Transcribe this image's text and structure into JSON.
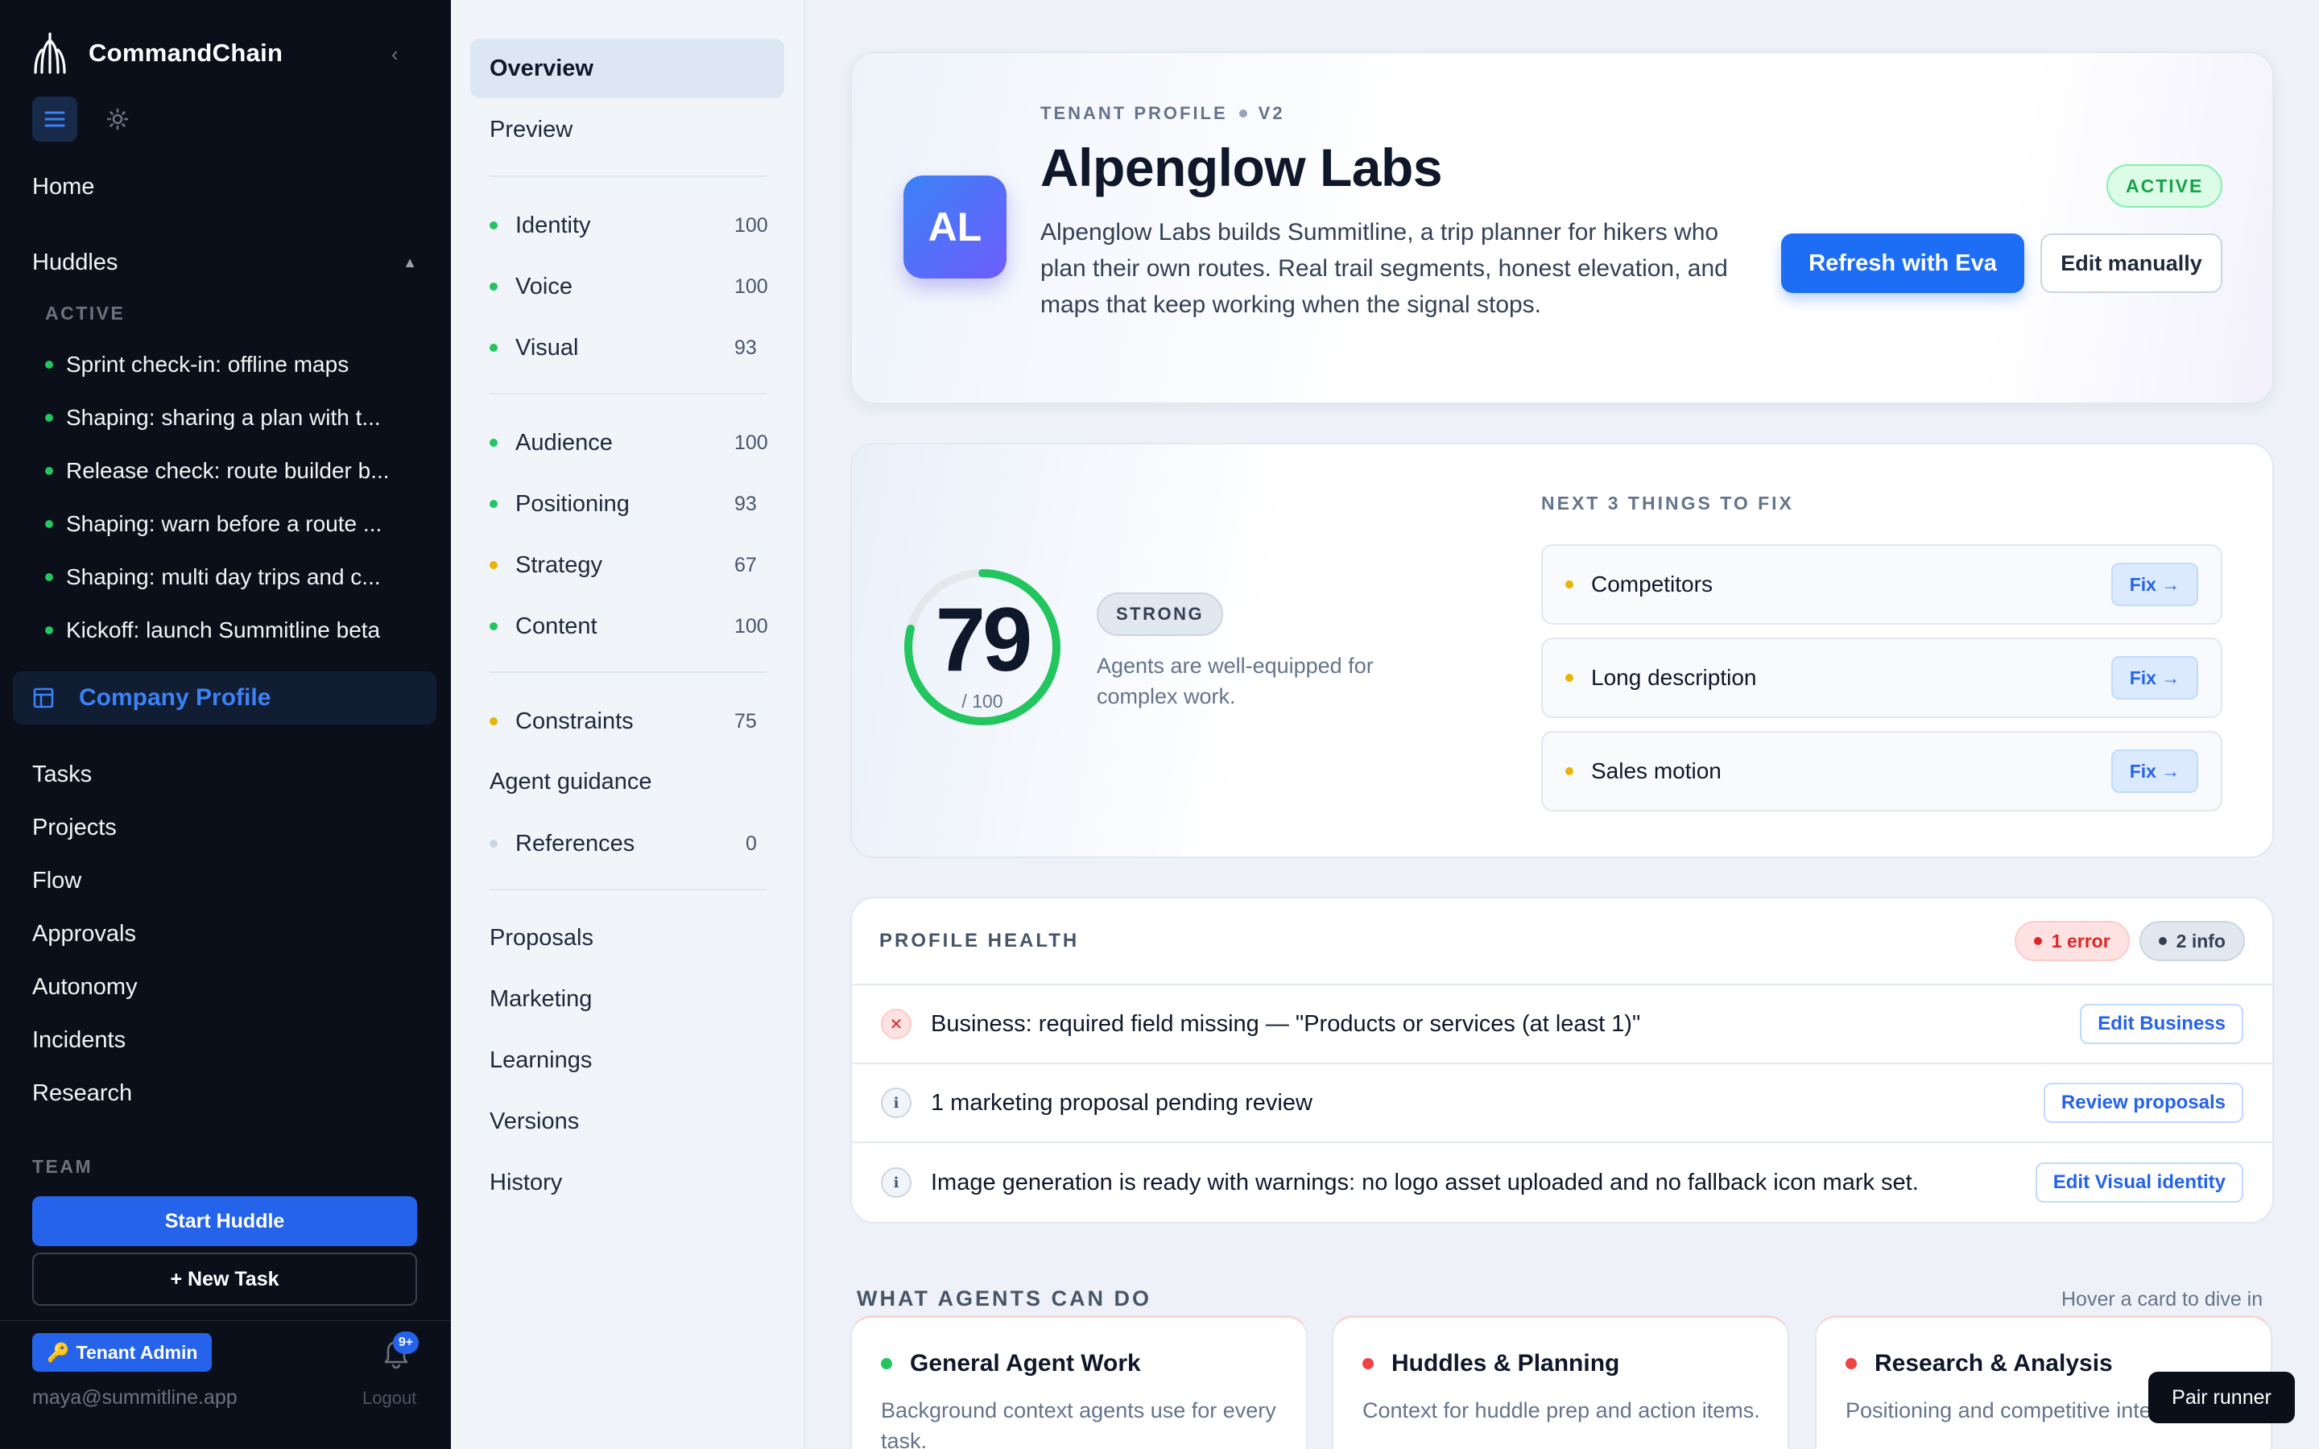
{
  "sidebar": {
    "brand": "CommandChain",
    "home": "Home",
    "huddles": "Huddles",
    "active_label": "ACTIVE",
    "huddles_list": [
      "Sprint check-in: offline maps",
      "Shaping: sharing a plan with t...",
      "Release check: route builder b...",
      "Shaping: warn before a route ...",
      "Shaping: multi day trips and c...",
      "Kickoff: launch Summitline beta"
    ],
    "company_profile": "Company Profile",
    "nav": [
      "Tasks",
      "Projects",
      "Flow",
      "Approvals",
      "Autonomy",
      "Incidents",
      "Research"
    ],
    "team_label": "TEAM",
    "start_huddle": "Start Huddle",
    "new_task": "+ New Task",
    "role": "Tenant Admin",
    "notifications": "9+",
    "email": "maya@summitline.app",
    "logout": "Logout"
  },
  "subnav": {
    "overview": "Overview",
    "preview": "Preview",
    "group1": [
      {
        "label": "Identity",
        "score": "100",
        "color": "#22c55e"
      },
      {
        "label": "Voice",
        "score": "100",
        "color": "#22c55e"
      },
      {
        "label": "Visual",
        "score": "93",
        "color": "#22c55e"
      }
    ],
    "group2": [
      {
        "label": "Audience",
        "score": "100",
        "color": "#22c55e"
      },
      {
        "label": "Positioning",
        "score": "93",
        "color": "#22c55e"
      },
      {
        "label": "Strategy",
        "score": "67",
        "color": "#eab308"
      },
      {
        "label": "Content",
        "score": "100",
        "color": "#22c55e"
      }
    ],
    "constraints": {
      "label": "Constraints",
      "score": "75",
      "color": "#eab308"
    },
    "agent_guidance": "Agent guidance",
    "references": {
      "label": "References",
      "score": "0",
      "color": "#cbd5e1"
    },
    "group3": [
      "Proposals",
      "Marketing",
      "Learnings",
      "Versions",
      "History"
    ]
  },
  "hero": {
    "initials": "AL",
    "eyebrow_left": "TENANT PROFILE",
    "eyebrow_right": "V2",
    "title": "Alpenglow Labs",
    "description": "Alpenglow Labs builds Summitline, a trip planner for hikers who plan their own routes. Real trail segments, honest elevation, and maps that keep working when the signal stops.",
    "status": "ACTIVE",
    "refresh": "Refresh with Eva",
    "edit": "Edit manually"
  },
  "score": {
    "value": "79",
    "max": "/ 100",
    "fraction": 0.79,
    "rating": "STRONG",
    "rating_desc": "Agents are well-equipped for complex work.",
    "fix_title": "NEXT 3 THINGS TO FIX",
    "fixes": [
      "Competitors",
      "Long description",
      "Sales motion"
    ],
    "fix_button": "Fix →"
  },
  "health": {
    "title": "PROFILE HEALTH",
    "errors": "1 error",
    "info": "2 info",
    "rows": [
      {
        "type": "error",
        "icon": "✕",
        "text": "Business: required field missing — \"Products or services (at least 1)\"",
        "action": "Edit Business"
      },
      {
        "type": "info",
        "icon": "i",
        "text": "1 marketing proposal pending review",
        "action": "Review proposals"
      },
      {
        "type": "info",
        "icon": "i",
        "text": "Image generation is ready with warnings: no logo asset uploaded and no fallback icon mark set.",
        "action": "Edit Visual identity"
      }
    ]
  },
  "agents": {
    "title": "WHAT AGENTS CAN DO",
    "hint": "Hover a card to dive in",
    "cards": [
      {
        "title": "General Agent Work",
        "desc": "Background context agents use for every task.",
        "color": "#22c55e"
      },
      {
        "title": "Huddles & Planning",
        "desc": "Context for huddle prep and action items.",
        "color": "#ef4444"
      },
      {
        "title": "Research & Analysis",
        "desc": "Positioning and competitive intelligence.",
        "color": "#ef4444"
      }
    ]
  },
  "pair_runner": "Pair runner"
}
